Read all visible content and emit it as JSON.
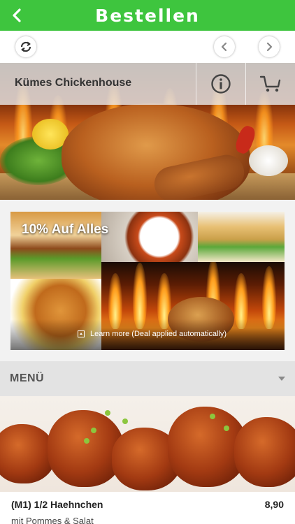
{
  "header": {
    "title": "Bestellen",
    "back_icon": "chevron-left-icon",
    "color": "#3ec53e"
  },
  "nav": {
    "refresh_icon": "refresh-icon",
    "prev_icon": "chevron-left-icon",
    "next_icon": "chevron-right-icon"
  },
  "restaurant": {
    "name": "Kümes Chickenhouse",
    "info_icon": "info-icon",
    "cart_icon": "cart-icon"
  },
  "deal": {
    "title": "10% Auf Alles",
    "learn_more": "Learn more (Deal applied automatically)"
  },
  "menu": {
    "label": "MENÜ"
  },
  "items": [
    {
      "name": "(M1) 1/2 Haehnchen",
      "price": "8,90",
      "description": "mit Pommes & Salat"
    }
  ]
}
